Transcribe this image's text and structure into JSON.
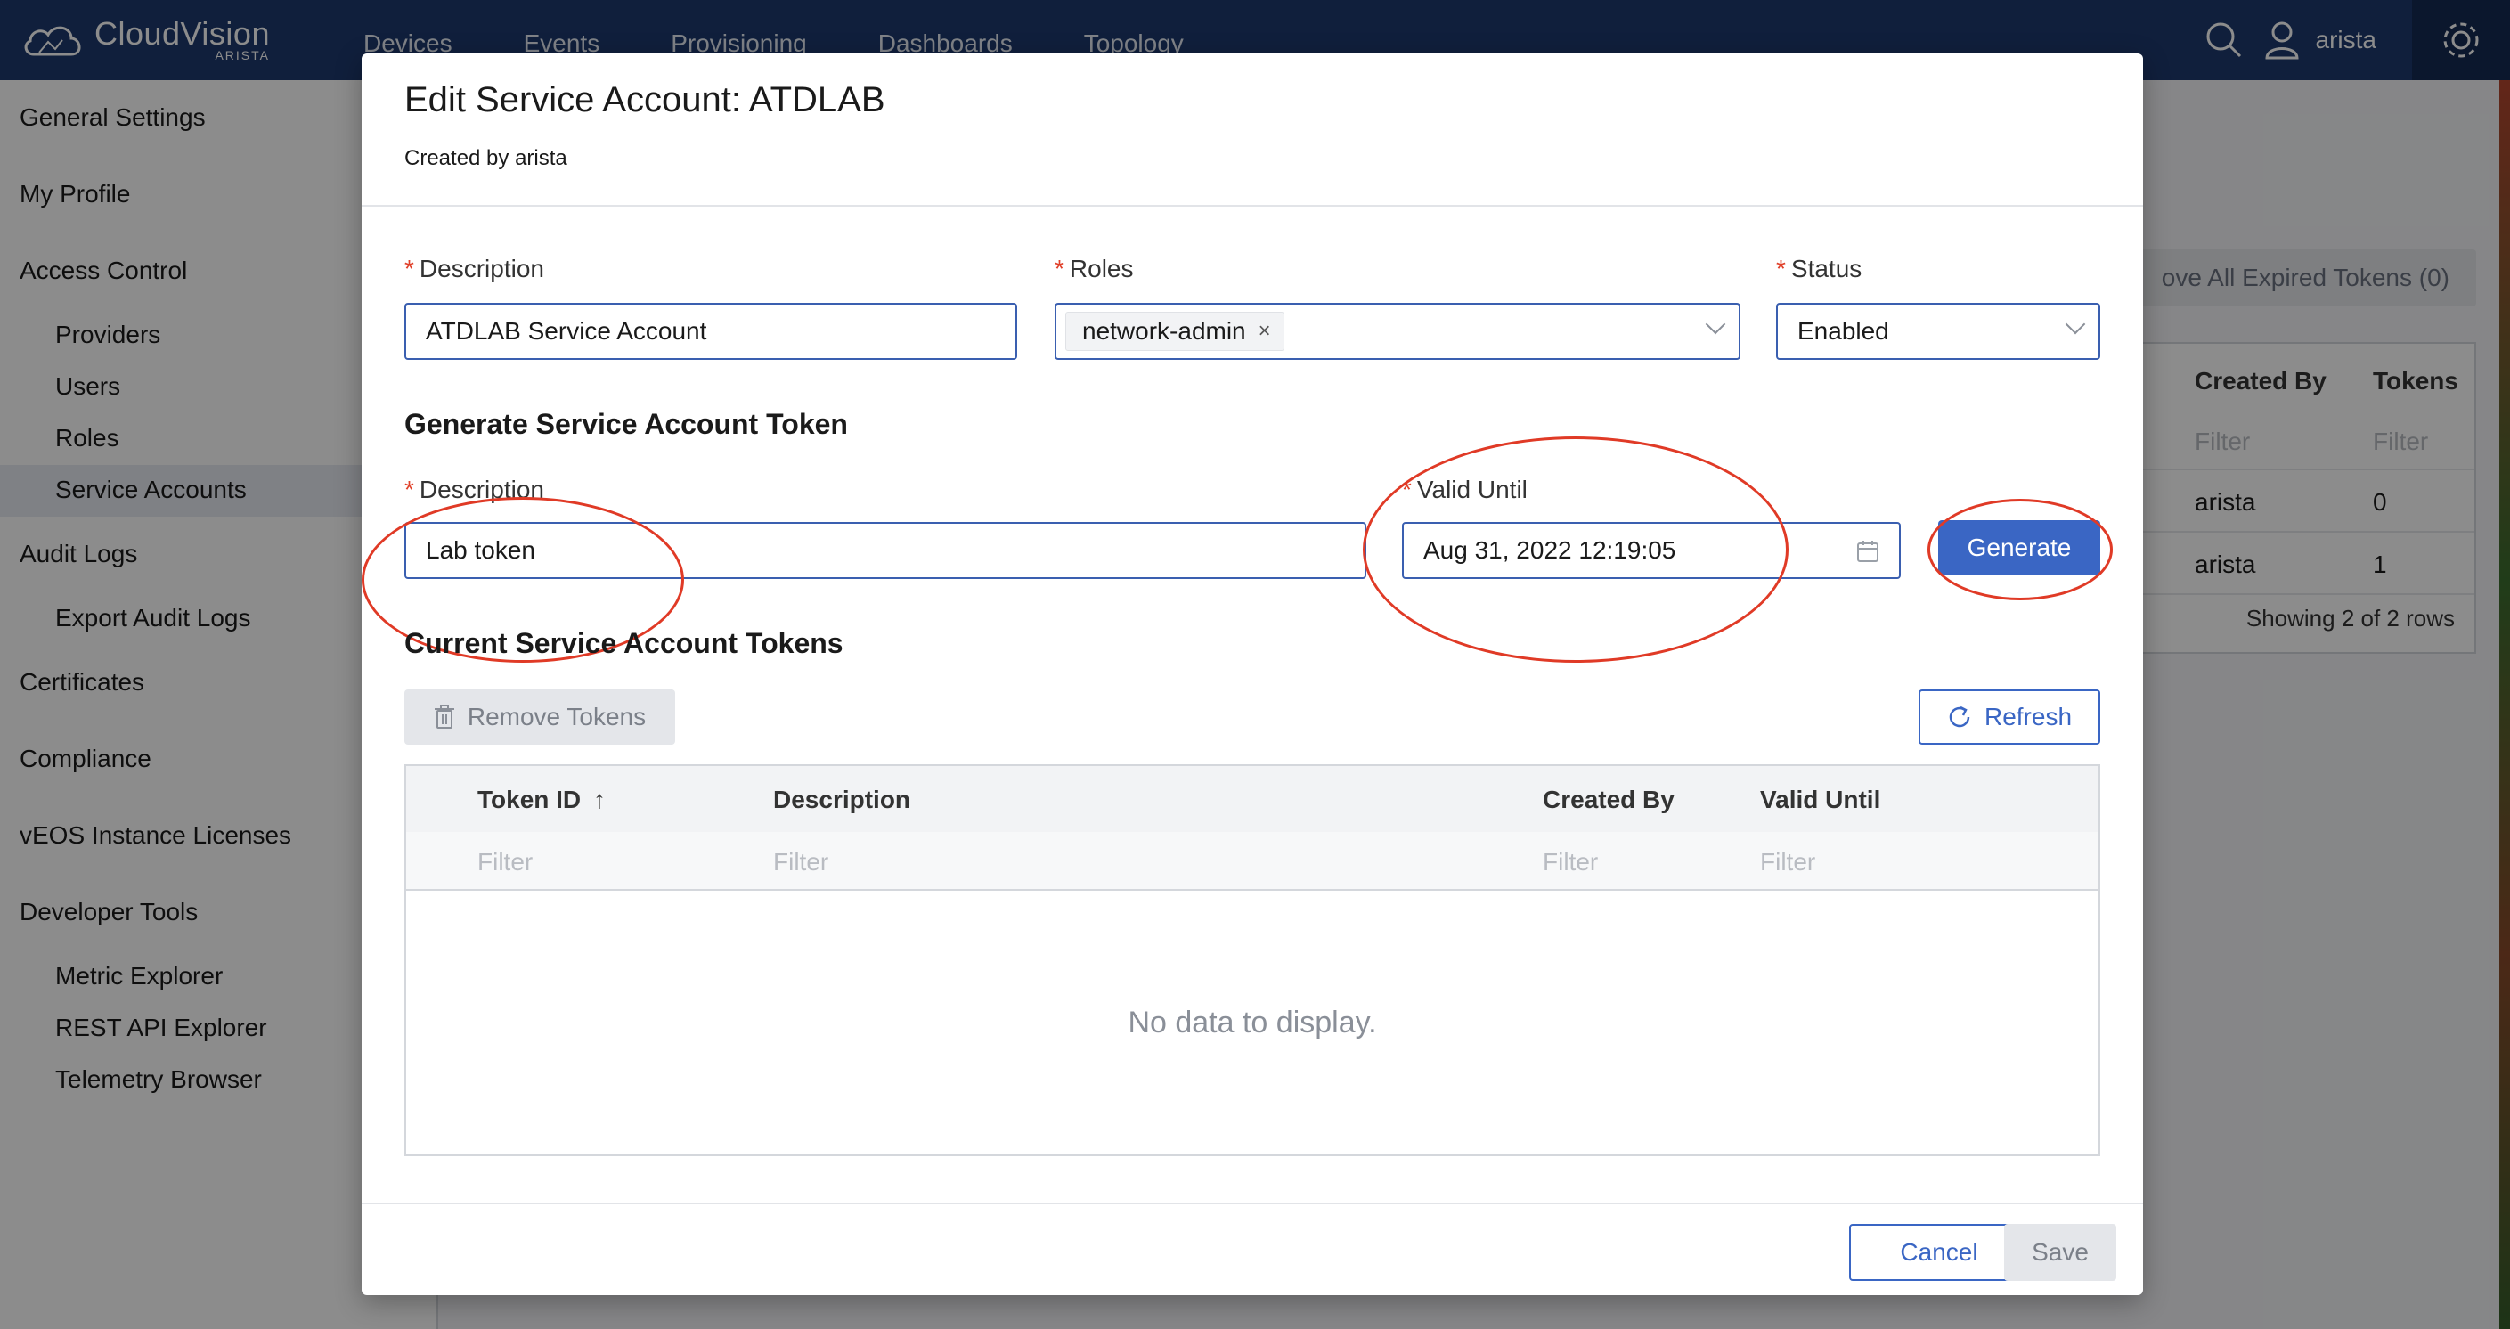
{
  "app": {
    "logo_name": "CloudVision",
    "logo_sub": "ARISTA",
    "nav": [
      "Devices",
      "Events",
      "Provisioning",
      "Dashboards",
      "Topology"
    ],
    "username": "arista"
  },
  "sidebar": {
    "items": [
      {
        "label": "General Settings"
      },
      {
        "label": "My Profile"
      },
      {
        "label": "Access Control"
      },
      {
        "label": "Providers"
      },
      {
        "label": "Users"
      },
      {
        "label": "Roles"
      },
      {
        "label": "Service Accounts"
      },
      {
        "label": "Audit Logs"
      },
      {
        "label": "Export Audit Logs"
      },
      {
        "label": "Certificates"
      },
      {
        "label": "Compliance"
      },
      {
        "label": "vEOS Instance Licenses"
      },
      {
        "label": "Developer Tools"
      },
      {
        "label": "Metric Explorer"
      },
      {
        "label": "REST API Explorer"
      },
      {
        "label": "Telemetry Browser"
      }
    ]
  },
  "background": {
    "remove_expired_label": "ove All Expired Tokens (0)",
    "columns": [
      "Created By",
      "Tokens"
    ],
    "filter": "Filter",
    "rows": [
      [
        "arista",
        "0"
      ],
      [
        "arista",
        "1"
      ]
    ],
    "footer": "Showing 2 of 2 rows"
  },
  "modal": {
    "title": "Edit Service Account: ATDLAB",
    "subtitle": "Created by arista",
    "required_mark": "*",
    "description_label": "Description",
    "description_value": "ATDLAB Service Account",
    "roles_label": "Roles",
    "roles_value": "network-admin",
    "roles_remove": "×",
    "status_label": "Status",
    "status_value": "Enabled",
    "generate_section": "Generate Service Account Token",
    "token_description_label": "Description",
    "token_description_value": "Lab token",
    "valid_until_label": "Valid Until",
    "valid_until_value": "Aug 31, 2022 12:19:05",
    "generate_button": "Generate",
    "tokens_section": "Current Service Account Tokens",
    "remove_tokens_button": "Remove Tokens",
    "refresh_button": "Refresh",
    "table": {
      "columns": [
        "Token ID",
        "Description",
        "Created By",
        "Valid Until"
      ],
      "sort_indicator": "↑",
      "filter": "Filter",
      "empty": "No data to display."
    },
    "cancel_button": "Cancel",
    "save_button": "Save"
  },
  "colors": {
    "nav_bg": "#1e3a6e",
    "primary": "#3a66c4",
    "annotation_ring": "#e03a26",
    "required": "#e0412a"
  },
  "icons": [
    "cloud-logo-icon",
    "search-icon",
    "user-icon",
    "gear-icon",
    "calendar-icon",
    "trash-icon",
    "refresh-icon",
    "chevron-down-icon"
  ]
}
